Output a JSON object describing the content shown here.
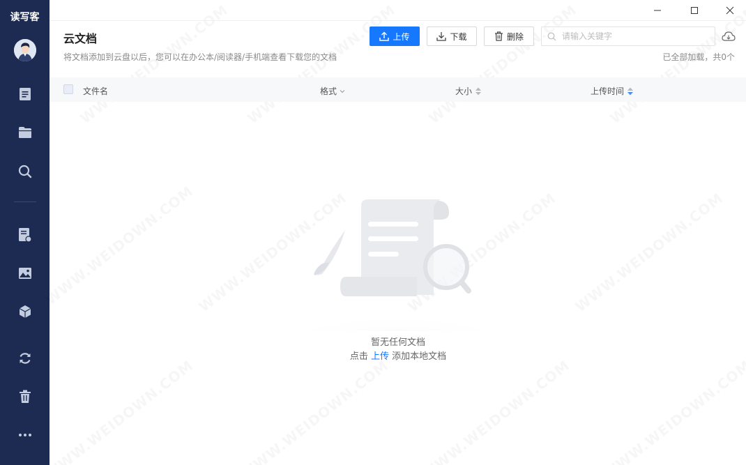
{
  "app": {
    "logo_text": "读写客"
  },
  "sidebar": {
    "items": [
      {
        "name": "document-icon"
      },
      {
        "name": "folder-icon"
      },
      {
        "name": "search-icon"
      },
      {
        "name": "note-icon"
      },
      {
        "name": "image-icon"
      },
      {
        "name": "cube-icon"
      },
      {
        "name": "sync-icon"
      },
      {
        "name": "trash-icon"
      },
      {
        "name": "more-icon"
      }
    ]
  },
  "window": {
    "controls": [
      "minimize",
      "maximize",
      "close"
    ]
  },
  "header": {
    "title": "云文档",
    "subtitle": "将文档添加到云盘以后，您可以在办公本/阅读器/手机端查看下载您的文档",
    "upload_label": "上传",
    "download_label": "下载",
    "delete_label": "删除",
    "search_placeholder": "请输入关键字",
    "loaded_status": "已全部加载，共0个"
  },
  "table": {
    "columns": [
      {
        "key": "name",
        "label": "文件名"
      },
      {
        "key": "format",
        "label": "格式"
      },
      {
        "key": "size",
        "label": "大小"
      },
      {
        "key": "upload_time",
        "label": "上传时间"
      }
    ],
    "rows": []
  },
  "empty_state": {
    "title": "暂无任何文档",
    "hint_prefix": "点击",
    "hint_link": "上传",
    "hint_suffix": "添加本地文档"
  },
  "watermark": {
    "text": "WWW.WEIDOWN.COM"
  },
  "colors": {
    "sidebar_bg": "#1d2b52",
    "accent": "#1677ff"
  }
}
